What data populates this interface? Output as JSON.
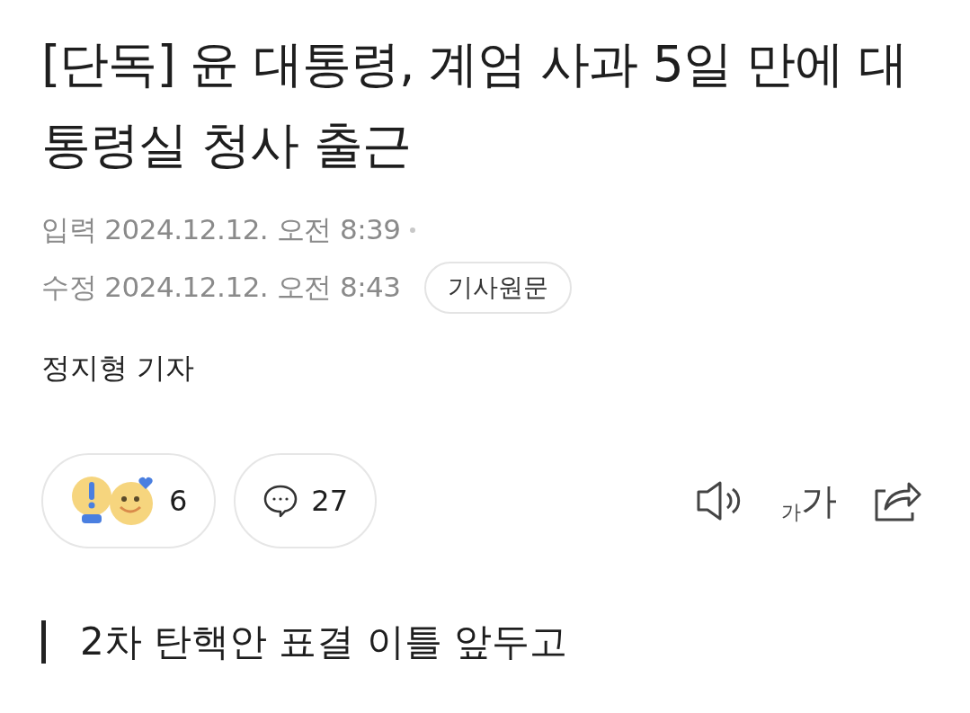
{
  "headline": "[단독] 윤 대통령, 계엄 사과 5일 만에 대통령실 청사 출근",
  "dates": [
    {
      "label": "입력",
      "value": "2024.12.12. 오전 8:39"
    },
    {
      "label": "수정",
      "value": "2024.12.12. 오전 8:43"
    }
  ],
  "original_link": "기사원문",
  "reporter": "정지형 기자",
  "reactions": {
    "count": "6"
  },
  "comments": {
    "count": "27"
  },
  "font_size": {
    "small": "가",
    "large": "가"
  },
  "subheading": "2차 탄핵안 표결 이틀 앞두고"
}
